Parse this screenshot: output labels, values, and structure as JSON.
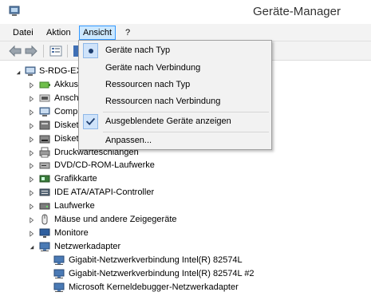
{
  "window": {
    "title": "Geräte-Manager",
    "app_icon": "device-manager-icon"
  },
  "menubar": {
    "items": [
      {
        "label": "Datei"
      },
      {
        "label": "Aktion"
      },
      {
        "label": "Ansicht"
      },
      {
        "label": "?"
      }
    ],
    "open_menu": "Ansicht"
  },
  "toolbar": {
    "buttons": [
      "back-arrow-icon",
      "forward-arrow-icon",
      "properties-icon",
      "help-icon"
    ]
  },
  "view_menu": {
    "items": [
      {
        "label": "Geräte nach Typ",
        "mark": "radio"
      },
      {
        "label": "Geräte nach Verbindung",
        "mark": "none"
      },
      {
        "label": "Ressourcen nach Typ",
        "mark": "none"
      },
      {
        "label": "Ressourcen nach Verbindung",
        "mark": "none"
      },
      {
        "label": "Ausgeblendete Geräte anzeigen",
        "mark": "check"
      },
      {
        "label": "Anpassen...",
        "mark": "none"
      }
    ]
  },
  "tree": {
    "root": {
      "label": "S-RDG-EX",
      "expanded": true
    },
    "categories": [
      {
        "label": "Akkus",
        "icon": "battery-icon"
      },
      {
        "label": "Ansch",
        "icon": "port-icon"
      },
      {
        "label": "Comp",
        "icon": "computer-icon"
      },
      {
        "label": "Disket",
        "icon": "floppy-controller-icon"
      },
      {
        "label": "Disket",
        "icon": "floppy-drive-icon"
      },
      {
        "label": "Druckwarteschlangen",
        "icon": "printer-icon"
      },
      {
        "label": "DVD/CD-ROM-Laufwerke",
        "icon": "dvd-drive-icon"
      },
      {
        "label": "Grafikkarte",
        "icon": "display-adapter-icon"
      },
      {
        "label": "IDE ATA/ATAPI-Controller",
        "icon": "ide-controller-icon"
      },
      {
        "label": "Laufwerke",
        "icon": "disk-drive-icon"
      },
      {
        "label": "Mäuse und andere Zeigegeräte",
        "icon": "mouse-icon"
      },
      {
        "label": "Monitore",
        "icon": "monitor-icon"
      },
      {
        "label": "Netzwerkadapter",
        "icon": "network-adapter-icon",
        "expanded": true
      }
    ],
    "network_children": [
      {
        "label": "Gigabit-Netzwerkverbindung Intel(R) 82574L"
      },
      {
        "label": "Gigabit-Netzwerkverbindung Intel(R) 82574L #2"
      },
      {
        "label": "Microsoft Kerneldebugger-Netzwerkadapter"
      }
    ]
  },
  "colors": {
    "menu_open_bg": "#cce8ff",
    "menu_open_border": "#3399ff",
    "dropdown_bg": "#f2f2f2",
    "highlight_bg": "#dbe9f9"
  }
}
